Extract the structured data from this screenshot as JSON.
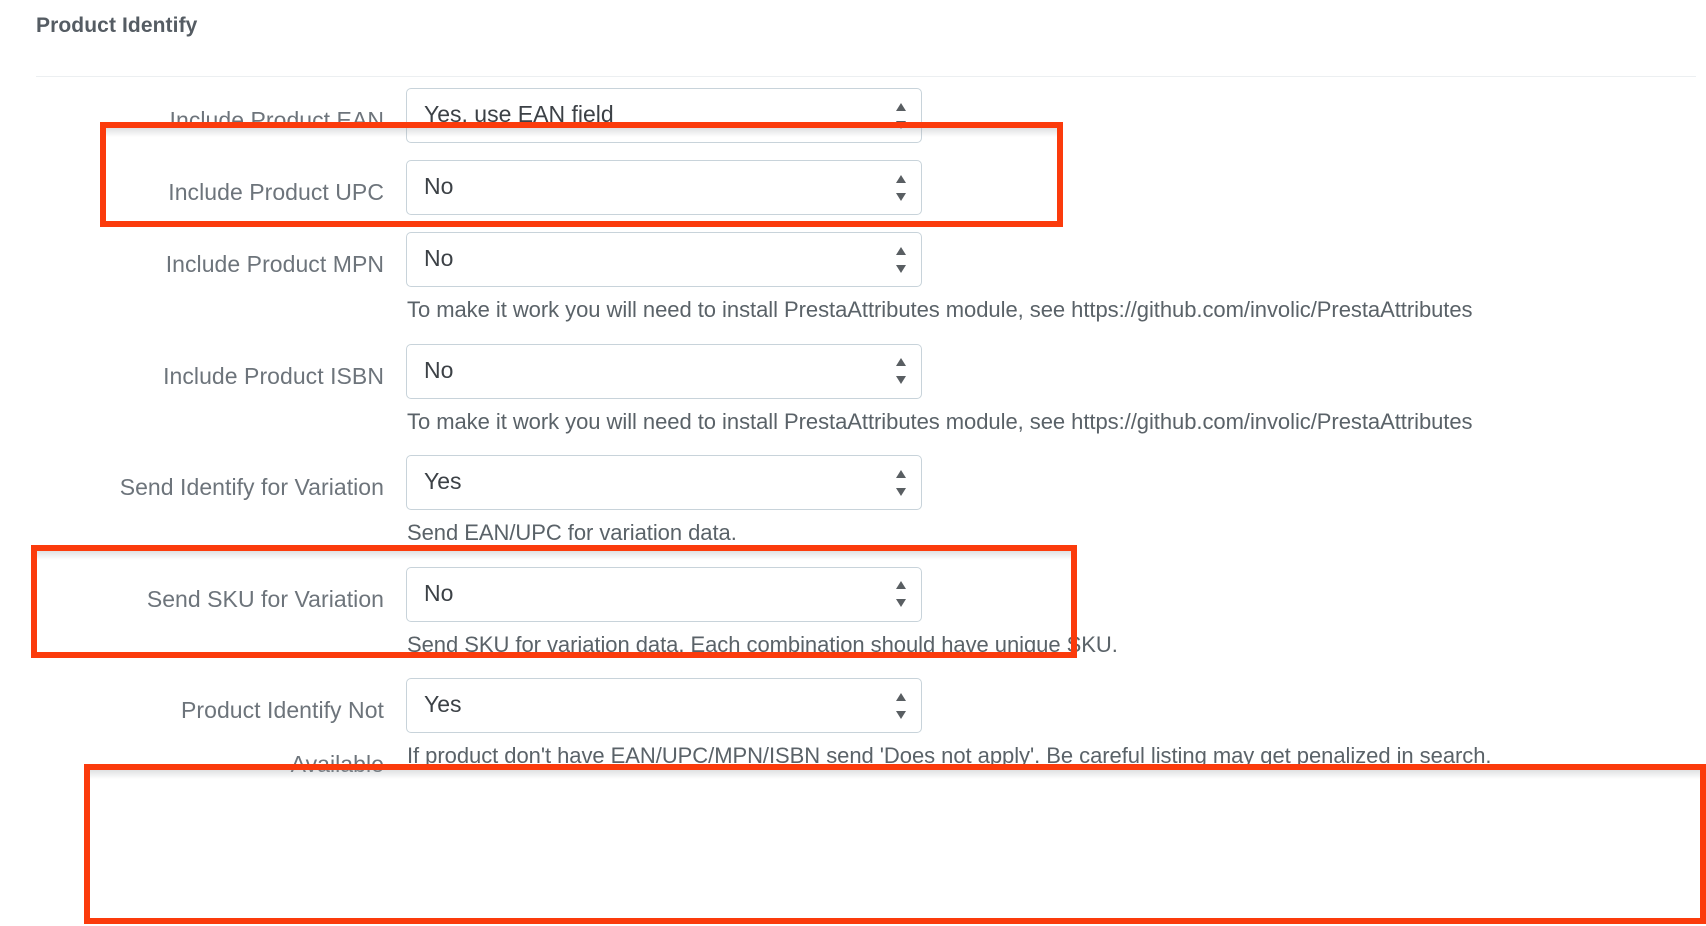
{
  "panel": {
    "title": "Product Identify"
  },
  "colors": {
    "annotation": "#fb3b0c",
    "label_text": "#6d747b",
    "value_text": "#3c4146",
    "help_text": "#5a6268",
    "select_border": "#c8d3da",
    "title_text": "#555c63"
  },
  "rows": [
    {
      "id": "include-product-ean",
      "label": "Include Product EAN",
      "value": "Yes, use EAN field",
      "help": "",
      "highlighted": true
    },
    {
      "id": "include-product-upc",
      "label": "Include Product UPC",
      "value": "No",
      "help": "",
      "highlighted": false
    },
    {
      "id": "include-product-mpn",
      "label": "Include Product MPN",
      "value": "No",
      "help": "To make it work you will need to install PrestaAttributes module, see https://github.com/involic/PrestaAttributes",
      "highlighted": false
    },
    {
      "id": "include-product-isbn",
      "label": "Include Product ISBN",
      "value": "No",
      "help": "To make it work you will need to install PrestaAttributes module, see https://github.com/involic/PrestaAttributes",
      "highlighted": false
    },
    {
      "id": "send-identify-for-variation",
      "label": "Send Identify for Variation",
      "value": "Yes",
      "help": "Send EAN/UPC for variation data.",
      "highlighted": true
    },
    {
      "id": "send-sku-for-variation",
      "label": "Send SKU for Variation",
      "value": "No",
      "help": "Send SKU for variation data. Each combination should have unique SKU.",
      "highlighted": false
    },
    {
      "id": "product-identify-not-available",
      "label": "Product Identify Not Available",
      "label_line1": "Product Identify Not",
      "label_line2": "Available",
      "value": "Yes",
      "help": "If product don't have EAN/UPC/MPN/ISBN send 'Does not apply'. Be careful listing may get penalized in search.",
      "highlighted": true
    }
  ],
  "select": {
    "arrow_icon": "updown-spinner-icon"
  }
}
